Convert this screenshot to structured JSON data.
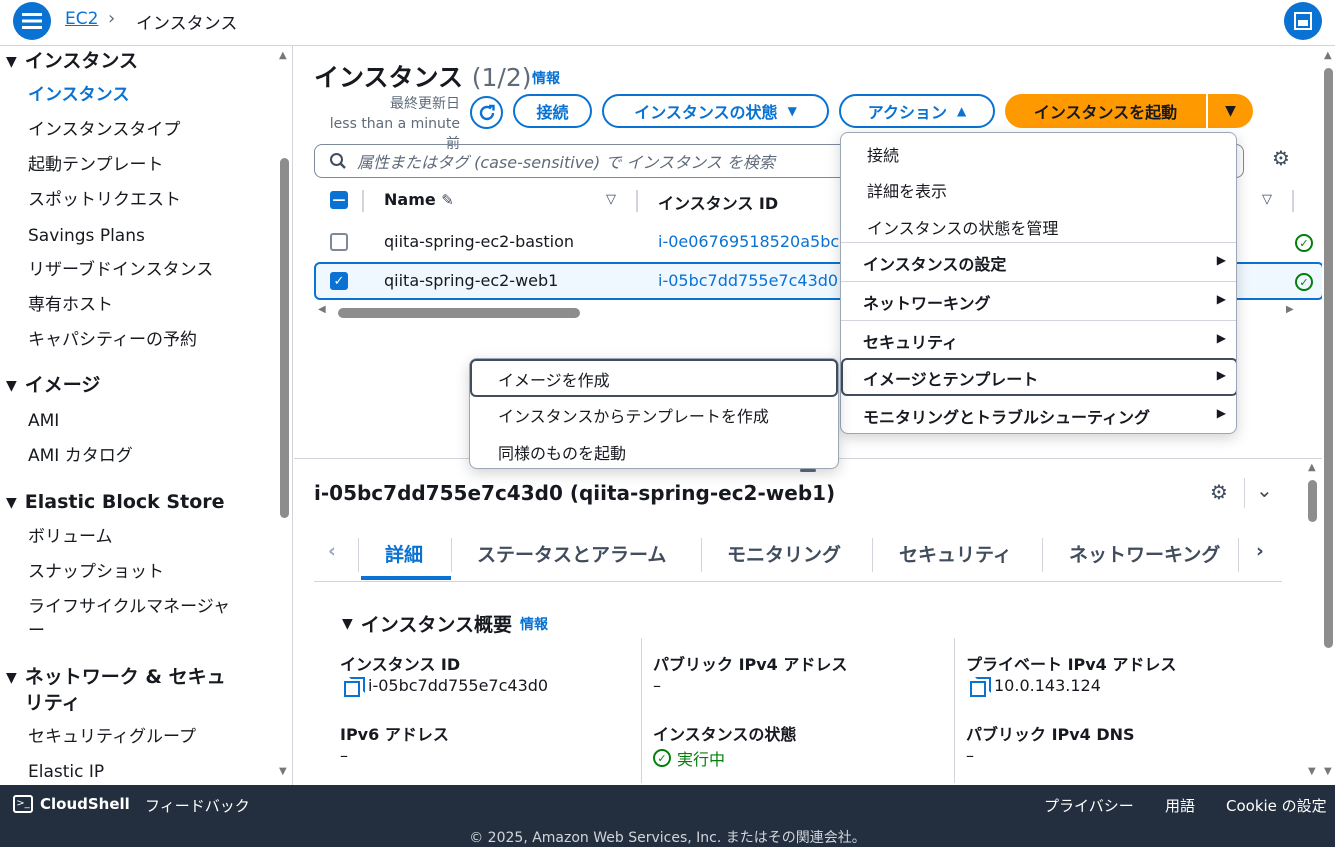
{
  "breadcrumb": {
    "service": "EC2",
    "sep": "›",
    "current": "インスタンス"
  },
  "sidebar": {
    "sections": [
      {
        "title": "インスタンス",
        "items": [
          "インスタンス",
          "インスタンスタイプ",
          "起動テンプレート",
          "スポットリクエスト",
          "Savings Plans",
          "リザーブドインスタンス",
          "専有ホスト",
          "キャパシティーの予約"
        ]
      },
      {
        "title": "イメージ",
        "items": [
          "AMI",
          "AMI カタログ"
        ]
      },
      {
        "title": "Elastic Block Store",
        "items": [
          "ボリューム",
          "スナップショット",
          "ライフサイクルマネージャー"
        ]
      },
      {
        "title": "ネットワーク & セキュリティ",
        "items": [
          "セキュリティグループ",
          "Elastic IP"
        ]
      }
    ],
    "lifecycle_line1": "ライフサイクルマネージャ",
    "lifecycle_line2": "ー",
    "network_line1": "ネットワーク & セキュ",
    "network_line2": "リティ"
  },
  "header": {
    "title": "インスタンス",
    "count": "(1/2)",
    "info": "情報",
    "updated_label": "最終更新日",
    "updated_value": "less than a minute 前",
    "connect": "接続",
    "instance_state": "インスタンスの状態",
    "actions": "アクション",
    "launch": "インスタンスを起動"
  },
  "search": {
    "placeholder": "属性またはタグ (case-sensitive) で インスタンス を検索"
  },
  "table": {
    "columns": [
      "Name",
      "インスタンス ID"
    ],
    "rows": [
      {
        "name": "qiita-spring-ec2-bastion",
        "id": "i-0e06769518520a5bc",
        "selected": false
      },
      {
        "name": "qiita-spring-ec2-web1",
        "id": "i-05bc7dd755e7c43d0",
        "selected": true
      }
    ]
  },
  "actions_menu": {
    "items": [
      "接続",
      "詳細を表示",
      "インスタンスの状態を管理"
    ],
    "groups": [
      "インスタンスの設定",
      "ネットワーキング",
      "セキュリティ",
      "イメージとテンプレート",
      "モニタリングとトラブルシューティング"
    ]
  },
  "submenu": {
    "items": [
      "イメージを作成",
      "インスタンスからテンプレートを作成",
      "同様のものを起動"
    ]
  },
  "detail": {
    "title": "i-05bc7dd755e7c43d0 (qiita-spring-ec2-web1)",
    "tabs": [
      "詳細",
      "ステータスとアラーム",
      "モニタリング",
      "セキュリティ",
      "ネットワーキング"
    ],
    "summary_title": "インスタンス概要",
    "summary_info": "情報",
    "fields": {
      "instance_id_label": "インスタンス ID",
      "instance_id_value": "i-05bc7dd755e7c43d0",
      "public_ipv4_label": "パブリック IPv4 アドレス",
      "public_ipv4_value": "–",
      "private_ipv4_label": "プライベート IPv4 アドレス",
      "private_ipv4_value": "10.0.143.124",
      "ipv6_label": "IPv6 アドレス",
      "ipv6_value": "–",
      "state_label": "インスタンスの状態",
      "state_value": "実行中",
      "public_dns_label": "パブリック IPv4 DNS",
      "public_dns_value": "–"
    }
  },
  "footer": {
    "cloudshell": "CloudShell",
    "feedback": "フィードバック",
    "privacy": "プライバシー",
    "language": "用語",
    "cookie": "Cookie の設定",
    "copyright": "© 2025, Amazon Web Services, Inc. またはその関連会社。"
  },
  "colors": {
    "accent": "#0972d3",
    "launch": "#ff9900",
    "footer_bg": "#232f3e",
    "running": "#037f0c"
  }
}
